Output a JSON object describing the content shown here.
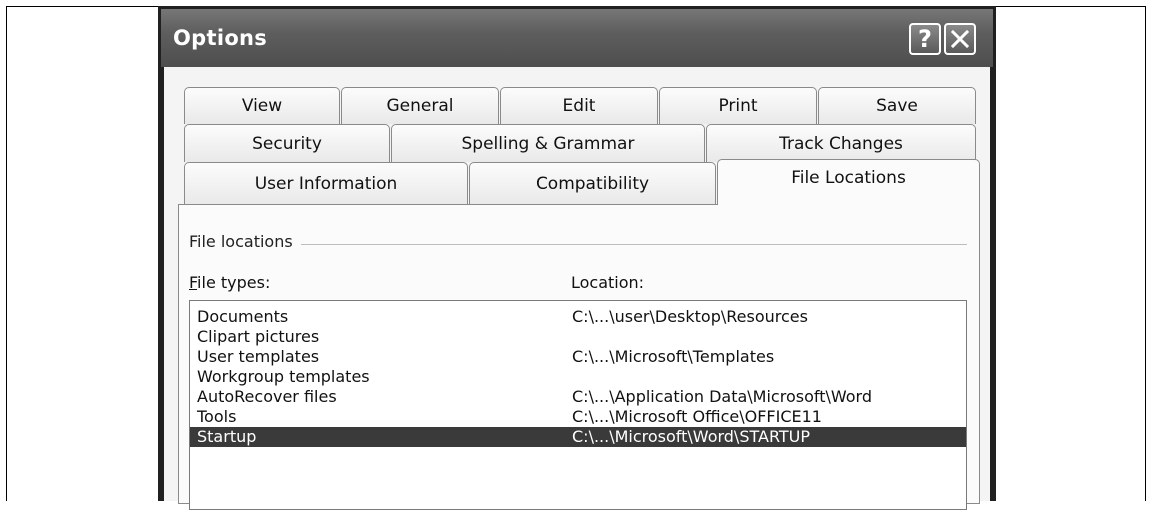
{
  "window": {
    "title": "Options",
    "help_label": "?"
  },
  "tabs": {
    "row1": [
      "View",
      "General",
      "Edit",
      "Print",
      "Save"
    ],
    "row2": [
      "Security",
      "Spelling & Grammar",
      "Track Changes"
    ],
    "row3": [
      "User Information",
      "Compatibility",
      "File Locations"
    ],
    "active": "File Locations"
  },
  "panel": {
    "group_label": "File locations",
    "file_types_label": "File types:",
    "file_types_mnemonic": "F",
    "file_types_rest": "ile types:",
    "location_label": "Location:",
    "rows": [
      {
        "type": "Documents",
        "location": "C:\\...\\user\\Desktop\\Resources"
      },
      {
        "type": "Clipart pictures",
        "location": ""
      },
      {
        "type": "User templates",
        "location": "C:\\...\\Microsoft\\Templates"
      },
      {
        "type": "Workgroup templates",
        "location": ""
      },
      {
        "type": "AutoRecover files",
        "location": "C:\\...\\Application Data\\Microsoft\\Word"
      },
      {
        "type": "Tools",
        "location": "C:\\...\\Microsoft Office\\OFFICE11"
      },
      {
        "type": "Startup",
        "location": "C:\\...\\Microsoft\\Word\\STARTUP"
      }
    ],
    "selected_row": "Startup"
  },
  "colors": {
    "selection": "#3a3a3a",
    "titlebar": "#5e5e5e"
  },
  "icons": {
    "help": "question-mark-icon",
    "close": "close-icon"
  }
}
